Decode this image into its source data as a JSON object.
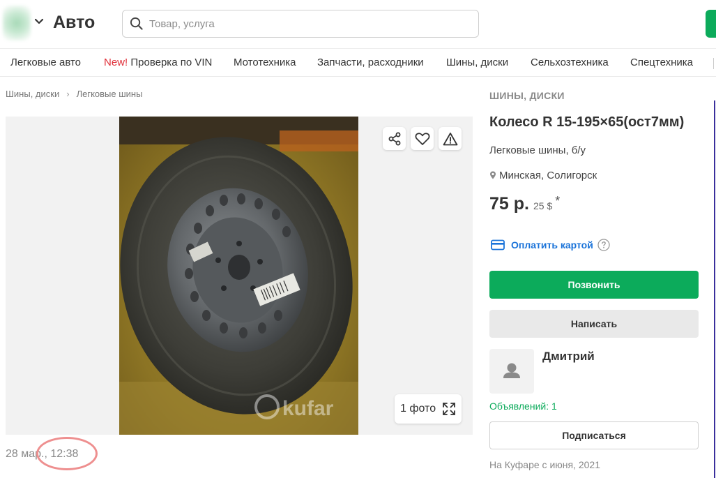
{
  "header": {
    "category_title": "Авто",
    "search_placeholder": "Товар, услуга"
  },
  "nav": {
    "items": [
      "Легковые авто",
      "Проверка по VIN",
      "Мототехника",
      "Запчасти, расходники",
      "Шины, диски",
      "Сельхозтехника",
      "Спецтехника"
    ],
    "new_badge": "New!"
  },
  "breadcrumb": [
    "Шины, диски",
    "Легковые шины"
  ],
  "gallery": {
    "photo_count_label": "1 фото",
    "watermark": "kufar"
  },
  "listing": {
    "date": "28 мар., 12:38",
    "category": "ШИНЫ, ДИСКИ",
    "title": "Колесо R 15-195×65(ост7мм)",
    "subtitle": "Легковые шины, б/у",
    "location": "Минская, Солигорск",
    "price": "75 р.",
    "price_usd": "25 $",
    "price_footnote": "*",
    "pay_by_card": "Оплатить картой",
    "call_button": "Позвонить",
    "write_button": "Написать"
  },
  "seller": {
    "name": "Дмитрий",
    "ads_count": "Объявлений: 1",
    "subscribe_button": "Подписаться",
    "since": "На Куфаре с июня, 2021"
  },
  "colors": {
    "brand_green": "#0cab5b",
    "link_blue": "#1a73d9",
    "new_red": "#e0303a",
    "annotation_circle": "#ee8f8f"
  }
}
